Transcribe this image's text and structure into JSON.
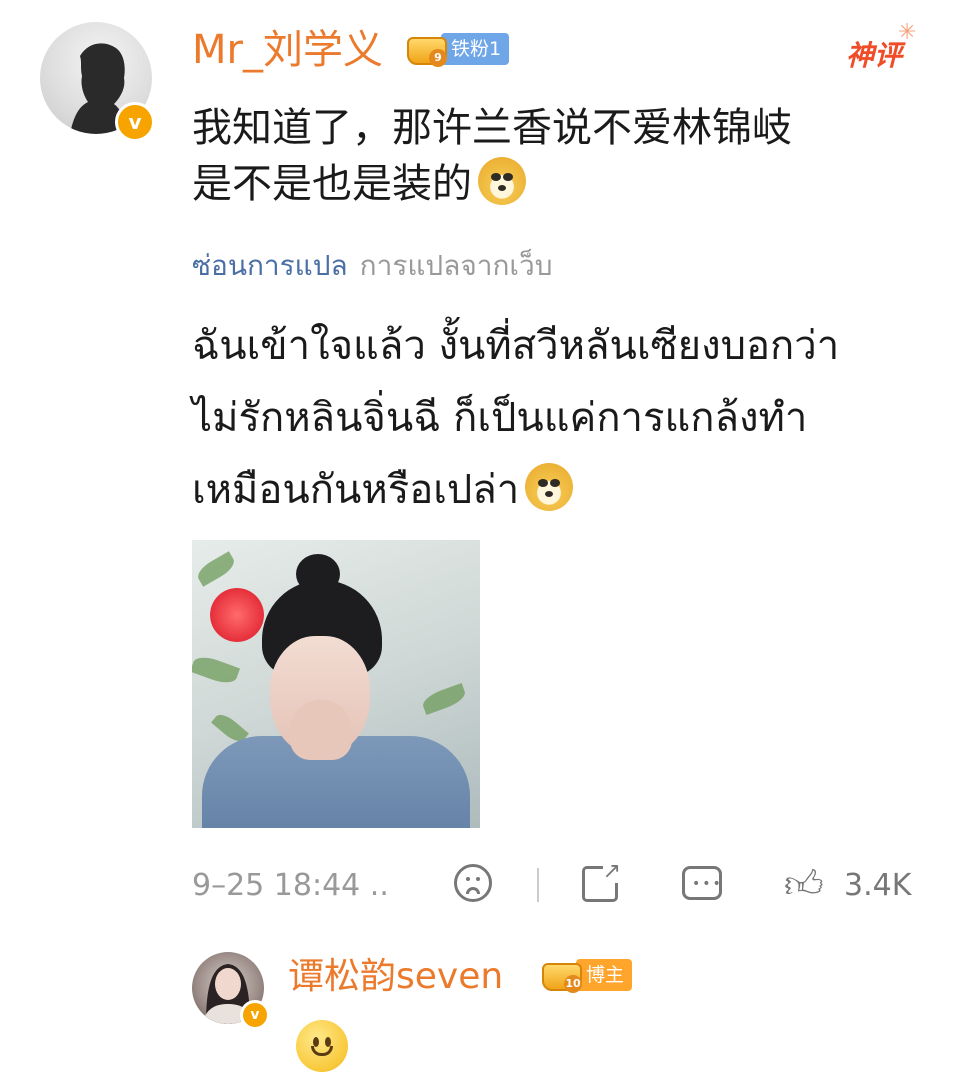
{
  "comment": {
    "author": "Mr_刘学义",
    "fan_badge_level": "铁粉1",
    "verified_badge": "v",
    "hot_label": "神评",
    "text_lines": [
      "我知道了，那许兰香说不爱林锦岐",
      "是不是也是装的"
    ],
    "translation": {
      "hide_label": "ซ่อนการแปล",
      "source_label": "การแปลจากเว็บ",
      "lines": [
        "ฉันเข้าใจแล้ว งั้นที่สวีหลันเซียงบอกว่า",
        "ไม่รักหลินจิ่นฉี ก็เป็นแค่การแกล้งทำ",
        "เหมือนกันหรือเปล่า"
      ]
    },
    "emoji": "doge-emoji",
    "timestamp": "9–25 18:44  ..",
    "likes": "3.4K",
    "actions": [
      "dislike-icon",
      "share-icon",
      "comment-icon",
      "like-icon"
    ]
  },
  "reply": {
    "author": "谭松韵seven",
    "badge": "博主",
    "verified_badge": "v",
    "emoji": "smile-emoji"
  },
  "colors": {
    "name": "#eb7a2c",
    "translation_link": "#4a6fa5",
    "fan_badge": "#6ea6e8",
    "author_badge": "#ffa52b",
    "hot": "#f04c28"
  }
}
